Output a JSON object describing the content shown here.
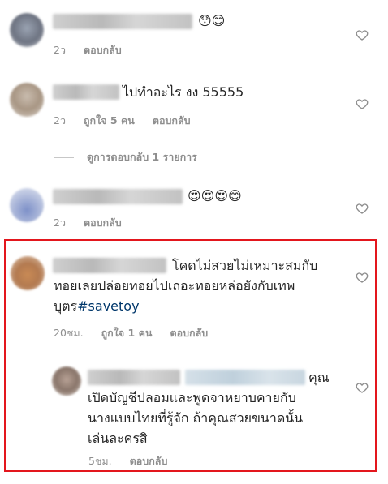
{
  "comments": [
    {
      "text": "😯😊",
      "time": "2ว",
      "likes": "",
      "reply": "ตอบกลับ"
    },
    {
      "text": "ไปทำอะไร งง 55555",
      "time": "2ว",
      "likes": "ถูกใจ 5 คน",
      "reply": "ตอบกลับ",
      "view_replies": "ดูการตอบกลับ 1 รายการ"
    },
    {
      "text": "😍😍😍😊",
      "time": "2ว",
      "likes": "",
      "reply": "ตอบกลับ"
    },
    {
      "line1": "โคดไม่สวยไม่เหมาะสมกับ",
      "line2": "ทอยเลยปล่อยทอยไปเถอะทอยหล่อยังกับเทพ",
      "line3_text": "บุตร",
      "hashtag": "#savetoy",
      "time": "20ชม.",
      "likes": "ถูกใจ 1 คน",
      "reply": "ตอบกลับ"
    },
    {
      "line1": "คุณ",
      "line2": "เปิดบัญชีปลอมและพูดจาหยาบคายกับ",
      "line3": "นางแบบไทยที่รู้จัก ถ้าคุณสวยขนาดนั้น",
      "line4": "เล่นละครสิ",
      "time": "5ชม.",
      "reply": "ตอบกลับ"
    }
  ],
  "colors": {
    "highlight": "#e3161d",
    "meta": "#8e8e8e",
    "hashtag": "#00376b"
  }
}
